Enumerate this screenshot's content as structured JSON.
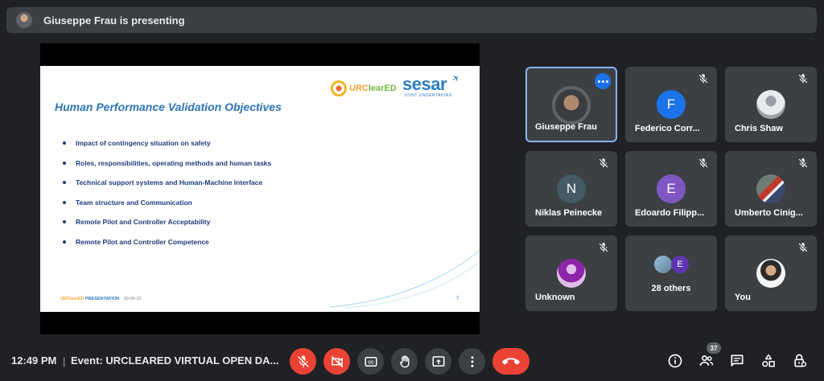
{
  "presenting_bar": {
    "text": "Giuseppe Frau is presenting"
  },
  "slide": {
    "title": "Human Performance Validation Objectives",
    "logo_urc": {
      "part1": "URC",
      "part2": "learED"
    },
    "logo_sesar": {
      "name": "sesar",
      "sub": "JOINT UNDERTAKING"
    },
    "bullets": [
      "Impact of contingency situation on safety",
      "Roles, responsibilities, operating methods and human tasks",
      "Technical support systems and Human-Machine Interface",
      "Team structure and Communication",
      "Remote Pilot and Controller Acceptability",
      "Remote Pilot and Controller Competence"
    ],
    "footer": {
      "brand": "URClearED",
      "label": "PRESENTATION",
      "date": "30-06-22"
    },
    "page_number": "7"
  },
  "participants": [
    {
      "name": "Giuseppe Frau",
      "initial": "",
      "avatar_color": "#5f6368"
    },
    {
      "name": "Federico Corr...",
      "initial": "F",
      "avatar_color": "#1a73e8"
    },
    {
      "name": "Chris Shaw",
      "initial": "",
      "avatar_color": "#e8eaed"
    },
    {
      "name": "Niklas Peinecke",
      "initial": "N",
      "avatar_color": "#455a64"
    },
    {
      "name": "Edoardo Filipp...",
      "initial": "E",
      "avatar_color": "#7e57c2"
    },
    {
      "name": "Umberto Cinig...",
      "initial": "",
      "avatar_color": "#4a5a50"
    },
    {
      "name": "Unknown",
      "initial": "",
      "avatar_color": "#8e24aa"
    },
    {
      "name": "28 others",
      "initial": "E",
      "avatar_color": "#5e35b1"
    },
    {
      "name": "You",
      "initial": "",
      "avatar_color": "#ffffff"
    }
  ],
  "bottom_bar": {
    "time": "12:49 PM",
    "separator": "|",
    "meeting_title": "Event: URCLEARED VIRTUAL OPEN DA...",
    "people_count": "37"
  },
  "colors": {
    "background": "#202124",
    "tile": "#3c4043",
    "danger": "#ea4335",
    "accent": "#1a73e8",
    "active_border": "#8ab4f8"
  },
  "icons": [
    "mic-off-icon",
    "camera-off-icon",
    "captions-icon",
    "raise-hand-icon",
    "present-screen-icon",
    "more-options-icon",
    "hang-up-icon",
    "info-icon",
    "people-icon",
    "chat-icon",
    "activities-icon",
    "host-controls-icon"
  ]
}
